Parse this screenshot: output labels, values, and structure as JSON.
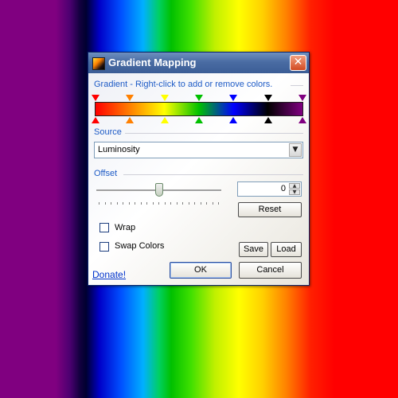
{
  "window": {
    "title": "Gradient Mapping",
    "close_label": "✕"
  },
  "gradient": {
    "label": "Gradient - Right-click to add or remove colors.",
    "stops": [
      {
        "color": "#ff0000",
        "position": 0.0
      },
      {
        "color": "#ff8000",
        "position": 0.167
      },
      {
        "color": "#ffff00",
        "position": 0.333
      },
      {
        "color": "#00c000",
        "position": 0.5
      },
      {
        "color": "#0000ff",
        "position": 0.667
      },
      {
        "color": "#000000",
        "position": 0.833
      },
      {
        "color": "#800080",
        "position": 1.0
      }
    ]
  },
  "source": {
    "label": "Source",
    "selected": "Luminosity"
  },
  "offset": {
    "label": "Offset",
    "value": "0",
    "slider_level": 0.5,
    "reset_label": "Reset"
  },
  "options": {
    "wrap_label": "Wrap",
    "wrap_checked": false,
    "swap_label": "Swap Colors",
    "swap_checked": false
  },
  "buttons": {
    "save": "Save",
    "load": "Load",
    "ok": "OK",
    "cancel": "Cancel"
  },
  "link": {
    "donate": "Donate!"
  },
  "colors": {
    "accent": "#1e5bc6",
    "title_bar": "#4a6ca3",
    "link": "#0033cc"
  }
}
